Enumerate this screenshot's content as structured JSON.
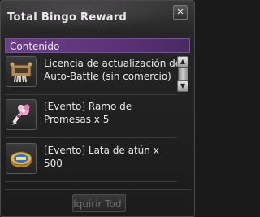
{
  "window": {
    "title": "Total Bingo Reward",
    "close_icon": "close-icon"
  },
  "section": {
    "label": "Contenido"
  },
  "items": [
    {
      "text": "Licencia de actualización de\nAuto-Battle (sin comercio)",
      "icon": "scroll-icon"
    },
    {
      "text": "[Evento] Ramo de\nPromesas x 5",
      "icon": "bouquet-icon"
    },
    {
      "text": "[Evento] Lata de atún x\n500",
      "icon": "tuna-can-icon"
    }
  ],
  "footer": {
    "claim_label": "dquirir Tod"
  },
  "colors": {
    "header_purple": "#6a3f86",
    "panel_bg": "#222222"
  }
}
